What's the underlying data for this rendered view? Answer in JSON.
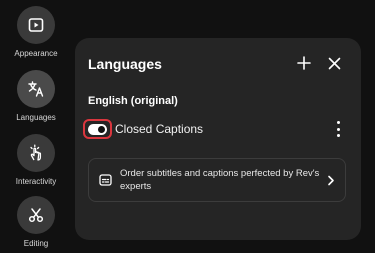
{
  "sidebar": {
    "items": [
      {
        "label": "Appearance",
        "icon": "play-square-icon"
      },
      {
        "label": "Languages",
        "icon": "translate-icon"
      },
      {
        "label": "Interactivity",
        "icon": "tap-hand-icon"
      },
      {
        "label": "Editing",
        "icon": "scissors-icon"
      }
    ],
    "active": "Languages"
  },
  "panel": {
    "title": "Languages",
    "add_icon": "plus-icon",
    "close_icon": "close-icon",
    "language_name": "English (original)",
    "captions": {
      "label": "Closed Captions",
      "toggle_on": true,
      "menu_icon": "kebab-menu-icon"
    },
    "order_card": {
      "text": "Order subtitles and captions perfected by Rev's experts",
      "icon": "captions-icon",
      "chevron": "chevron-right-icon"
    }
  },
  "colors": {
    "background": "#111111",
    "panel": "#252525",
    "sidebar_icon_bg": "#3a3a3a",
    "highlight_border": "#d9363e"
  }
}
